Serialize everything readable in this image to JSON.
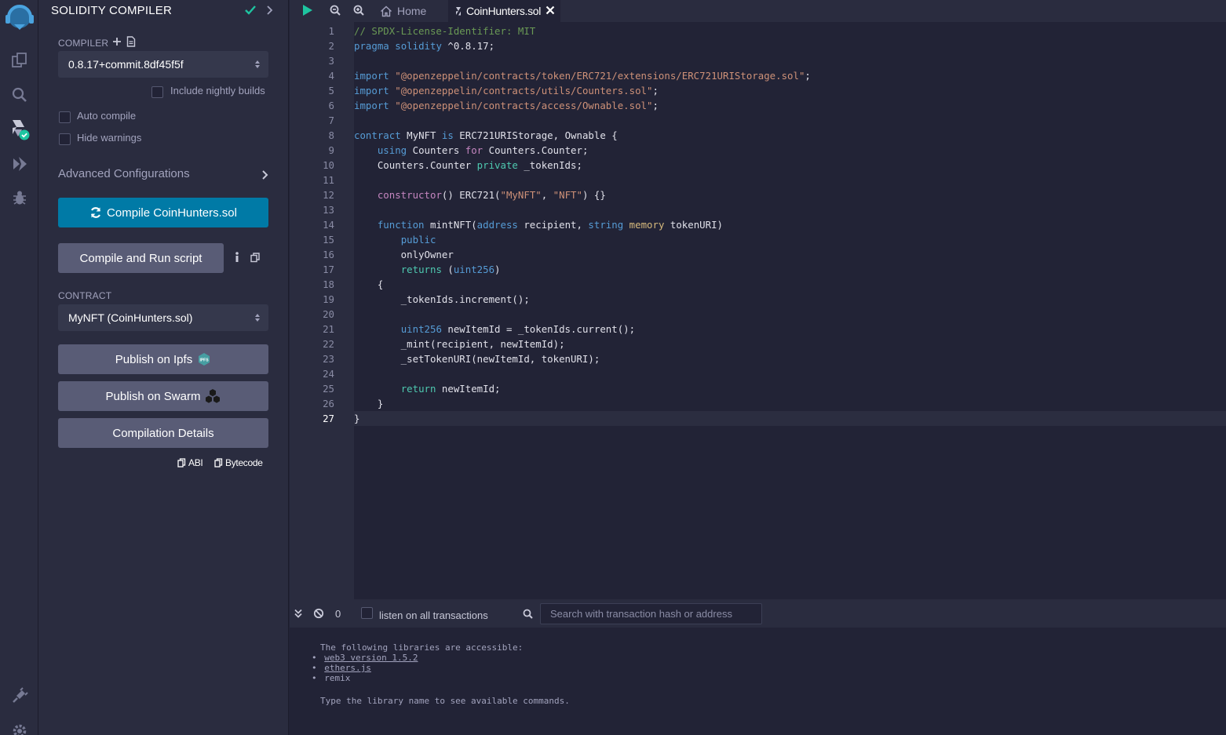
{
  "panel": {
    "title": "SOLIDITY COMPILER",
    "compiler_label": "COMPILER",
    "compiler_version": "0.8.17+commit.8df45f5f",
    "include_nightly": "Include nightly builds",
    "auto_compile": "Auto compile",
    "hide_warnings": "Hide warnings",
    "advanced": "Advanced Configurations",
    "compile_button": "Compile CoinHunters.sol",
    "compile_run_button": "Compile and Run script",
    "contract_label": "CONTRACT",
    "contract_value": "MyNFT (CoinHunters.sol)",
    "publish_ipfs": "Publish on Ipfs",
    "ipfs_badge": "IPFS",
    "publish_swarm": "Publish on Swarm",
    "compilation_details": "Compilation Details",
    "abi": "ABI",
    "bytecode": "Bytecode"
  },
  "tabs": {
    "home": "Home",
    "active": "CoinHunters.sol"
  },
  "editor": {
    "current_line": 27,
    "lines": [
      [
        [
          "// SPDX-License-Identifier: MIT",
          "#6a9955"
        ]
      ],
      [
        [
          "pragma",
          "#569cd6"
        ],
        [
          " "
        ],
        [
          "solidity",
          "#569cd6"
        ],
        [
          " ^0.8.17;"
        ]
      ],
      [],
      [
        [
          "import",
          "#569cd6"
        ],
        [
          " "
        ],
        [
          "\"@openzeppelin/contracts/token/ERC721/extensions/ERC721URIStorage.sol\"",
          "#ce9178"
        ],
        [
          ";"
        ]
      ],
      [
        [
          "import",
          "#569cd6"
        ],
        [
          " "
        ],
        [
          "\"@openzeppelin/contracts/utils/Counters.sol\"",
          "#ce9178"
        ],
        [
          ";"
        ]
      ],
      [
        [
          "import",
          "#569cd6"
        ],
        [
          " "
        ],
        [
          "\"@openzeppelin/contracts/access/Ownable.sol\"",
          "#ce9178"
        ],
        [
          ";"
        ]
      ],
      [],
      [
        [
          "contract",
          "#569cd6"
        ],
        [
          " MyNFT "
        ],
        [
          "is",
          "#569cd6"
        ],
        [
          " ERC721URIStorage, Ownable {"
        ]
      ],
      [
        [
          "    "
        ],
        [
          "using",
          "#569cd6"
        ],
        [
          " Counters "
        ],
        [
          "for",
          "#c586c0"
        ],
        [
          " Counters.Counter;"
        ]
      ],
      [
        [
          "    Counters.Counter "
        ],
        [
          "private",
          "#4ec9b0"
        ],
        [
          " _tokenIds;"
        ]
      ],
      [],
      [
        [
          "    "
        ],
        [
          "constructor",
          "#c586c0"
        ],
        [
          "() ERC721("
        ],
        [
          "\"MyNFT\"",
          "#ce9178"
        ],
        [
          ", "
        ],
        [
          "\"NFT\"",
          "#ce9178"
        ],
        [
          ") {}"
        ]
      ],
      [],
      [
        [
          "    "
        ],
        [
          "function",
          "#569cd6"
        ],
        [
          " mintNFT("
        ],
        [
          "address",
          "#569cd6"
        ],
        [
          " recipient, "
        ],
        [
          "string",
          "#569cd6"
        ],
        [
          " "
        ],
        [
          "memory",
          "#d7ba7d"
        ],
        [
          " tokenURI)"
        ]
      ],
      [
        [
          "        "
        ],
        [
          "public",
          "#569cd6"
        ]
      ],
      [
        [
          "        onlyOwner"
        ]
      ],
      [
        [
          "        "
        ],
        [
          "returns",
          "#4ec9b0"
        ],
        [
          " ("
        ],
        [
          "uint256",
          "#569cd6"
        ],
        [
          ")"
        ]
      ],
      [
        [
          "    {"
        ]
      ],
      [
        [
          "        _tokenIds.increment();"
        ]
      ],
      [],
      [
        [
          "        "
        ],
        [
          "uint256",
          "#569cd6"
        ],
        [
          " newItemId = _tokenIds.current();"
        ]
      ],
      [
        [
          "        _mint(recipient, newItemId);"
        ]
      ],
      [
        [
          "        _setTokenURI(newItemId, tokenURI);"
        ]
      ],
      [],
      [
        [
          "        "
        ],
        [
          "return",
          "#4ec9b0"
        ],
        [
          " newItemId;"
        ]
      ],
      [
        [
          "    }"
        ]
      ],
      [
        [
          "}"
        ]
      ]
    ]
  },
  "terminal": {
    "count": "0",
    "listen_label": "listen on all transactions",
    "search_placeholder": "Search with transaction hash or address",
    "intro": "The following libraries are accessible:",
    "libs": [
      "web3 version 1.5.2",
      "ethers.js",
      "remix"
    ],
    "footer": "Type the library name to see available commands."
  },
  "colors": {
    "accent": "#007aa6",
    "check": "#1ec4a0"
  }
}
